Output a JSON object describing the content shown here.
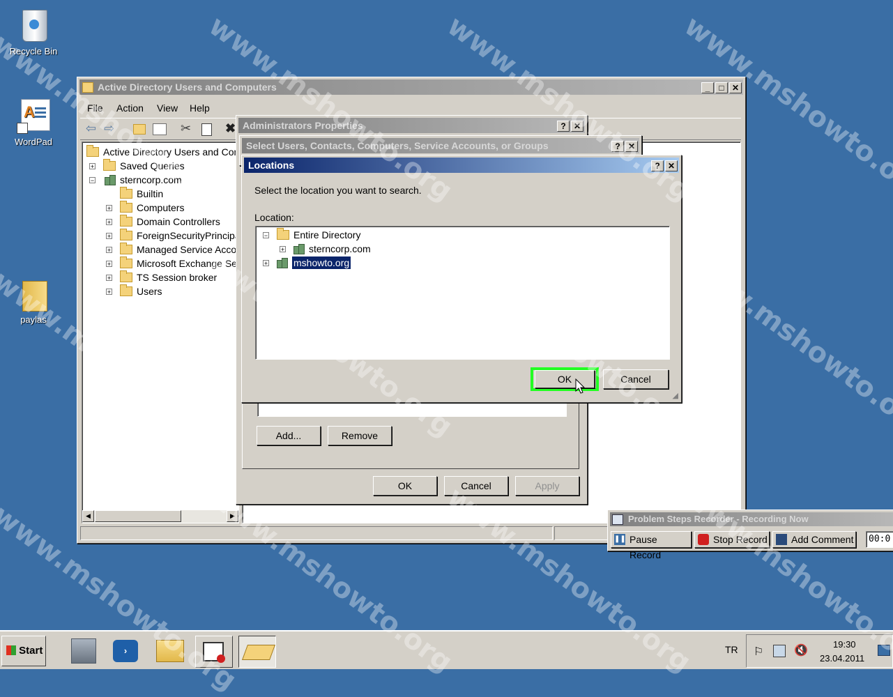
{
  "desktop": {
    "icons": [
      {
        "label": "Recycle Bin"
      },
      {
        "label": "WordPad"
      },
      {
        "label": "paylas"
      }
    ]
  },
  "aduc": {
    "title": "Active Directory Users and Computers",
    "menu": [
      "File",
      "Action",
      "View",
      "Help"
    ],
    "tree": [
      {
        "label": "Active Directory Users and Com"
      },
      {
        "label": "Saved Queries"
      },
      {
        "label": "sterncorp.com"
      },
      {
        "label": "Builtin"
      },
      {
        "label": "Computers"
      },
      {
        "label": "Domain Controllers"
      },
      {
        "label": "ForeignSecurityPrincipal"
      },
      {
        "label": "Managed Service Accou"
      },
      {
        "label": "Microsoft Exchange Sec"
      },
      {
        "label": "TS Session broker"
      },
      {
        "label": "Users"
      }
    ]
  },
  "admin_props": {
    "title": "Administrators Properties",
    "add_label": "Add...",
    "remove_label": "Remove",
    "ok_label": "OK",
    "cancel_label": "Cancel",
    "apply_label": "Apply"
  },
  "select_users": {
    "title": "Select Users, Contacts, Computers, Service Accounts, or Groups"
  },
  "locations": {
    "title": "Locations",
    "instruction": "Select the location you want to search.",
    "location_label": "Location:",
    "tree": [
      {
        "label": "Entire Directory"
      },
      {
        "label": "sterncorp.com"
      },
      {
        "label": "mshowto.org"
      }
    ],
    "ok_label": "OK",
    "cancel_label": "Cancel",
    "highlight_color": "#22ff22",
    "selection_color": "#0a246a"
  },
  "psr": {
    "title": "Problem Steps Recorder - Recording Now",
    "pause_label": "Pause Record",
    "stop_label": "Stop Record",
    "comment_label": "Add Comment",
    "timer": "00:0"
  },
  "taskbar": {
    "start_label": "Start",
    "lang": "TR",
    "time": "19:30",
    "date": "23.04.2011"
  },
  "watermark_text": "www.mshowto.org",
  "window_controls": {
    "help": "?",
    "close": "✕",
    "minimize": "_",
    "maximize": "□"
  }
}
